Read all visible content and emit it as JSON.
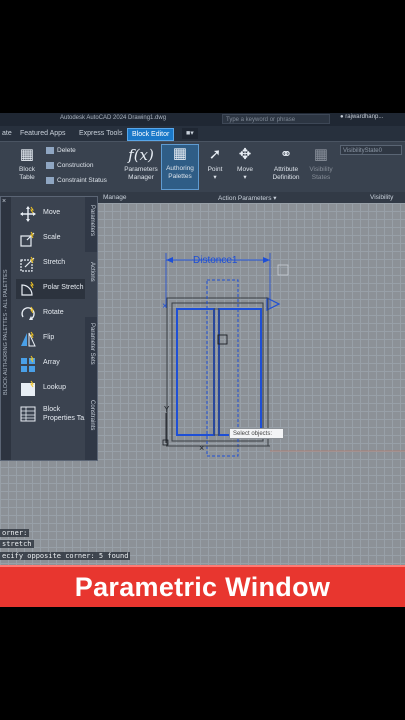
{
  "window": {
    "title": "Autodesk AutoCAD 2024   Drawing1.dwg",
    "search_placeholder": "Type a keyword or phrase",
    "user": "rajwardhanp..."
  },
  "tabs": [
    {
      "label": "ate"
    },
    {
      "label": "Featured Apps"
    },
    {
      "label": "Express Tools"
    },
    {
      "label": "Block Editor",
      "active": true
    }
  ],
  "ribbon": {
    "block_table": "Block\nTable",
    "delete": "Delete",
    "construction": "Construction",
    "constraint_status": "Constraint Status",
    "parameters_manager": "Parameters\nManager",
    "authoring_palettes": "Authoring\nPalettes",
    "point": "Point",
    "move": "Move",
    "attribute_definition": "Attribute\nDefinition",
    "visibility_states": "Visibility\nStates",
    "visibility_state_value": "VisibilityState0",
    "panels": {
      "manage": "Manage",
      "action_parameters": "Action Parameters",
      "visibility": "Visibility"
    }
  },
  "palette": {
    "side_title": "BLOCK AUTHORING PALETTES - ALL PALETTES",
    "vertical_tabs": [
      "Parameters",
      "Actions",
      "Parameter Sets",
      "Constraints"
    ],
    "active_tab": "Actions",
    "items": [
      {
        "label": "Move"
      },
      {
        "label": "Scale"
      },
      {
        "label": "Stretch"
      },
      {
        "label": "Polar Stretch",
        "selected": true
      },
      {
        "label": "Rotate"
      },
      {
        "label": "Flip"
      },
      {
        "label": "Array"
      },
      {
        "label": "Lookup"
      },
      {
        "label": "Block\nProperties Ta..."
      }
    ]
  },
  "drawing": {
    "parameter_label": "Distonce1",
    "tooltip": "Select objects:"
  },
  "command_line": [
    "orner:",
    "stretch",
    "ecify opposite corner: 5 found"
  ],
  "banner": {
    "text": "Parametric Window"
  },
  "colors": {
    "accent": "#1a78c8",
    "banner": "#e8362f",
    "window_lines": "#1e4fd6"
  }
}
